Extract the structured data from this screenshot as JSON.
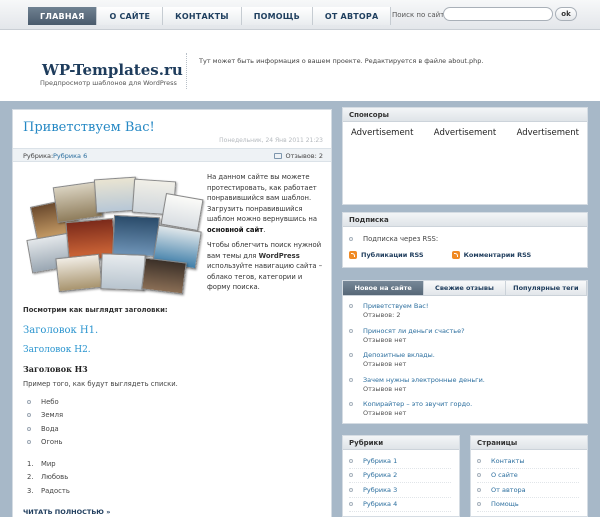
{
  "nav": {
    "items": [
      "ГЛАВНАЯ",
      "О САЙТЕ",
      "КОНТАКТЫ",
      "ПОМОЩЬ",
      "ОТ АВТОРА"
    ],
    "active_index": 0
  },
  "search": {
    "label": "Поиск по сайту",
    "value": "",
    "button": "ok"
  },
  "header": {
    "title": "WP-Templates.ru",
    "tagline": "Предпросмотр шаблонов для WordPress",
    "about": "Тут может быть информация о вашем проекте. Редактируется в файле about.php."
  },
  "post": {
    "title": "Приветствуем Вас!",
    "date": "Понедельник, 24 Янв 2011 21:23",
    "rubric_label": "Рубрика:",
    "rubric": "Рубрика 6",
    "comments": "Отзывов: 2",
    "intro_text": "На данном сайте вы можете протестировать, как работает понравившийся вам шаблон. Загрузить понравившийся шаблон можно вернувшись на ",
    "intro_link": "основной сайт",
    "intro_end": ".",
    "intro2_a": "Чтобы облегчить поиск нужной вам темы для ",
    "intro2_link": "WordPress",
    "intro2_b": " используйте навигацию сайта – облако тегов, категории и форму поиска.",
    "headings_label": "Посмотрим как выглядят заголовки:",
    "h1": "Заголовок H1.",
    "h2": "Заголовок H2.",
    "h3": "Заголовок H3",
    "list_intro": "Пример того, как будут выглядеть списки.",
    "ul": [
      "Небо",
      "Земля",
      "Вода",
      "Огонь"
    ],
    "ol": [
      "Мир",
      "Любовь",
      "Радость"
    ],
    "read_more": "ЧИТАТЬ ПОЛНОСТЬЮ »"
  },
  "sponsors": {
    "title": "Спонсоры",
    "ads": [
      "Advertisement",
      "Advertisement",
      "Advertisement"
    ]
  },
  "subscribe": {
    "title": "Подписка",
    "text": "Подписка через RSS:",
    "rss_posts": "Публикации RSS",
    "rss_comments": "Комментарии RSS"
  },
  "tabs": {
    "labels": [
      "Новое на сайте",
      "Свежие отзывы",
      "Популярные теги"
    ],
    "active_index": 0,
    "items": [
      {
        "link": "Приветствуем Вас!",
        "sub": "Отзывов: 2"
      },
      {
        "link": "Приносят ли деньги счастье?",
        "sub": "Отзывов нет"
      },
      {
        "link": "Депозитные вклады.",
        "sub": "Отзывов нет"
      },
      {
        "link": "Зачем нужны электронные деньги.",
        "sub": "Отзывов нет"
      },
      {
        "link": "Копирайтер – это звучит гордо.",
        "sub": "Отзывов нет"
      }
    ]
  },
  "rubrics": {
    "title": "Рубрики",
    "items": [
      "Рубрика 1",
      "Рубрика 2",
      "Рубрика 3",
      "Рубрика 4"
    ]
  },
  "pages": {
    "title": "Страницы",
    "items": [
      "Контакты",
      "О сайте",
      "От автора",
      "Помощь"
    ]
  },
  "colors": {
    "accent": "#2b95cf",
    "nav_active": "#4a5b6c",
    "page_bg": "#a7b8c8",
    "link": "#2b6e9e"
  }
}
